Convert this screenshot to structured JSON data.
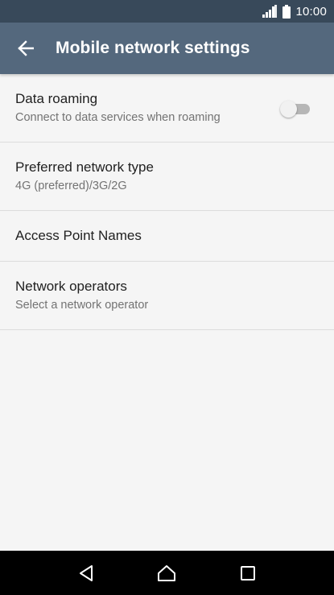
{
  "status_bar": {
    "time": "10:00",
    "icons": [
      "signal-icon",
      "battery-icon"
    ]
  },
  "app_bar": {
    "back_icon": "arrow-left-icon",
    "title": "Mobile network settings",
    "color": "#54687d"
  },
  "settings": {
    "items": [
      {
        "title": "Data roaming",
        "summary": "Connect to data services when roaming",
        "toggle": {
          "on": false
        }
      },
      {
        "title": "Preferred network type",
        "summary": "4G (preferred)/3G/2G"
      },
      {
        "title": "Access Point Names"
      },
      {
        "title": "Network operators",
        "summary": "Select a network operator"
      }
    ]
  },
  "nav_bar": {
    "buttons": [
      "back-triangle-icon",
      "home-icon",
      "recents-square-icon"
    ]
  }
}
